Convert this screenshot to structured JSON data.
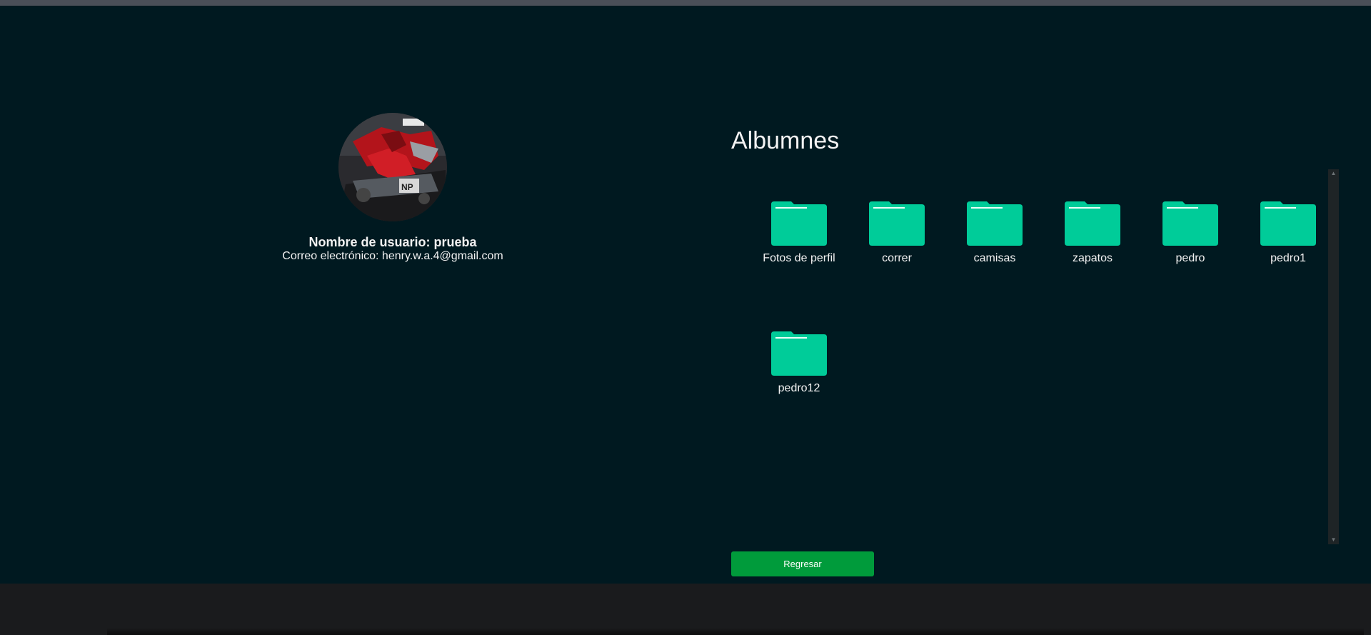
{
  "profile": {
    "username_line": "Nombre de usuario: prueba",
    "email_line": "Correo electrónico: henry.w.a.4@gmail.com"
  },
  "albums": {
    "title": "Albumnes",
    "items": [
      {
        "label": "Fotos de perfil"
      },
      {
        "label": "correr"
      },
      {
        "label": "camisas"
      },
      {
        "label": "zapatos"
      },
      {
        "label": "pedro"
      },
      {
        "label": "pedro1"
      },
      {
        "label": "pedro12"
      }
    ]
  },
  "actions": {
    "back_label": "Regresar"
  },
  "colors": {
    "page_bg": "#001920",
    "folder": "#00cc99",
    "button": "#009b3b"
  }
}
